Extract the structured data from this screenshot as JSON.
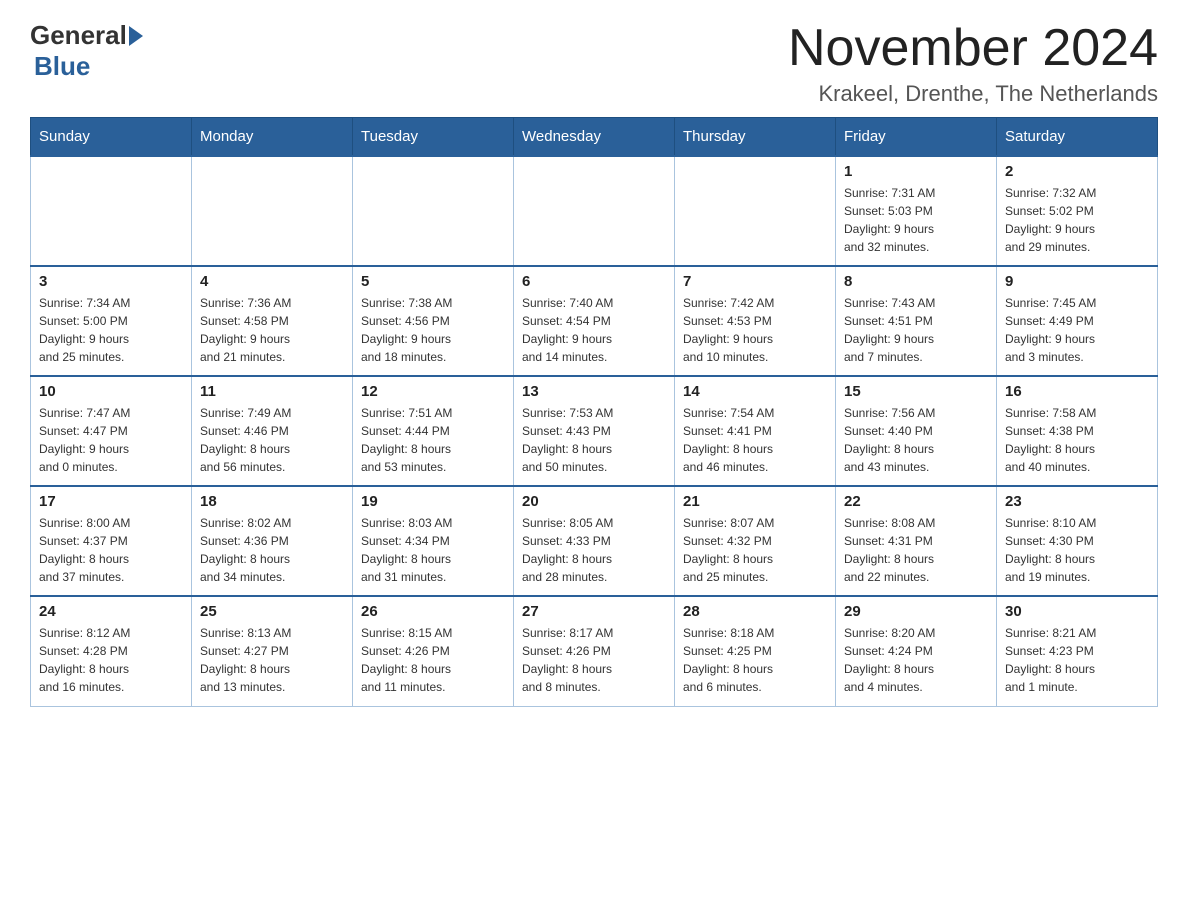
{
  "header": {
    "logo_general": "General",
    "logo_blue": "Blue",
    "month_title": "November 2024",
    "location": "Krakeel, Drenthe, The Netherlands"
  },
  "calendar": {
    "weekdays": [
      "Sunday",
      "Monday",
      "Tuesday",
      "Wednesday",
      "Thursday",
      "Friday",
      "Saturday"
    ],
    "weeks": [
      [
        {
          "day": "",
          "info": ""
        },
        {
          "day": "",
          "info": ""
        },
        {
          "day": "",
          "info": ""
        },
        {
          "day": "",
          "info": ""
        },
        {
          "day": "",
          "info": ""
        },
        {
          "day": "1",
          "info": "Sunrise: 7:31 AM\nSunset: 5:03 PM\nDaylight: 9 hours\nand 32 minutes."
        },
        {
          "day": "2",
          "info": "Sunrise: 7:32 AM\nSunset: 5:02 PM\nDaylight: 9 hours\nand 29 minutes."
        }
      ],
      [
        {
          "day": "3",
          "info": "Sunrise: 7:34 AM\nSunset: 5:00 PM\nDaylight: 9 hours\nand 25 minutes."
        },
        {
          "day": "4",
          "info": "Sunrise: 7:36 AM\nSunset: 4:58 PM\nDaylight: 9 hours\nand 21 minutes."
        },
        {
          "day": "5",
          "info": "Sunrise: 7:38 AM\nSunset: 4:56 PM\nDaylight: 9 hours\nand 18 minutes."
        },
        {
          "day": "6",
          "info": "Sunrise: 7:40 AM\nSunset: 4:54 PM\nDaylight: 9 hours\nand 14 minutes."
        },
        {
          "day": "7",
          "info": "Sunrise: 7:42 AM\nSunset: 4:53 PM\nDaylight: 9 hours\nand 10 minutes."
        },
        {
          "day": "8",
          "info": "Sunrise: 7:43 AM\nSunset: 4:51 PM\nDaylight: 9 hours\nand 7 minutes."
        },
        {
          "day": "9",
          "info": "Sunrise: 7:45 AM\nSunset: 4:49 PM\nDaylight: 9 hours\nand 3 minutes."
        }
      ],
      [
        {
          "day": "10",
          "info": "Sunrise: 7:47 AM\nSunset: 4:47 PM\nDaylight: 9 hours\nand 0 minutes."
        },
        {
          "day": "11",
          "info": "Sunrise: 7:49 AM\nSunset: 4:46 PM\nDaylight: 8 hours\nand 56 minutes."
        },
        {
          "day": "12",
          "info": "Sunrise: 7:51 AM\nSunset: 4:44 PM\nDaylight: 8 hours\nand 53 minutes."
        },
        {
          "day": "13",
          "info": "Sunrise: 7:53 AM\nSunset: 4:43 PM\nDaylight: 8 hours\nand 50 minutes."
        },
        {
          "day": "14",
          "info": "Sunrise: 7:54 AM\nSunset: 4:41 PM\nDaylight: 8 hours\nand 46 minutes."
        },
        {
          "day": "15",
          "info": "Sunrise: 7:56 AM\nSunset: 4:40 PM\nDaylight: 8 hours\nand 43 minutes."
        },
        {
          "day": "16",
          "info": "Sunrise: 7:58 AM\nSunset: 4:38 PM\nDaylight: 8 hours\nand 40 minutes."
        }
      ],
      [
        {
          "day": "17",
          "info": "Sunrise: 8:00 AM\nSunset: 4:37 PM\nDaylight: 8 hours\nand 37 minutes."
        },
        {
          "day": "18",
          "info": "Sunrise: 8:02 AM\nSunset: 4:36 PM\nDaylight: 8 hours\nand 34 minutes."
        },
        {
          "day": "19",
          "info": "Sunrise: 8:03 AM\nSunset: 4:34 PM\nDaylight: 8 hours\nand 31 minutes."
        },
        {
          "day": "20",
          "info": "Sunrise: 8:05 AM\nSunset: 4:33 PM\nDaylight: 8 hours\nand 28 minutes."
        },
        {
          "day": "21",
          "info": "Sunrise: 8:07 AM\nSunset: 4:32 PM\nDaylight: 8 hours\nand 25 minutes."
        },
        {
          "day": "22",
          "info": "Sunrise: 8:08 AM\nSunset: 4:31 PM\nDaylight: 8 hours\nand 22 minutes."
        },
        {
          "day": "23",
          "info": "Sunrise: 8:10 AM\nSunset: 4:30 PM\nDaylight: 8 hours\nand 19 minutes."
        }
      ],
      [
        {
          "day": "24",
          "info": "Sunrise: 8:12 AM\nSunset: 4:28 PM\nDaylight: 8 hours\nand 16 minutes."
        },
        {
          "day": "25",
          "info": "Sunrise: 8:13 AM\nSunset: 4:27 PM\nDaylight: 8 hours\nand 13 minutes."
        },
        {
          "day": "26",
          "info": "Sunrise: 8:15 AM\nSunset: 4:26 PM\nDaylight: 8 hours\nand 11 minutes."
        },
        {
          "day": "27",
          "info": "Sunrise: 8:17 AM\nSunset: 4:26 PM\nDaylight: 8 hours\nand 8 minutes."
        },
        {
          "day": "28",
          "info": "Sunrise: 8:18 AM\nSunset: 4:25 PM\nDaylight: 8 hours\nand 6 minutes."
        },
        {
          "day": "29",
          "info": "Sunrise: 8:20 AM\nSunset: 4:24 PM\nDaylight: 8 hours\nand 4 minutes."
        },
        {
          "day": "30",
          "info": "Sunrise: 8:21 AM\nSunset: 4:23 PM\nDaylight: 8 hours\nand 1 minute."
        }
      ]
    ]
  }
}
